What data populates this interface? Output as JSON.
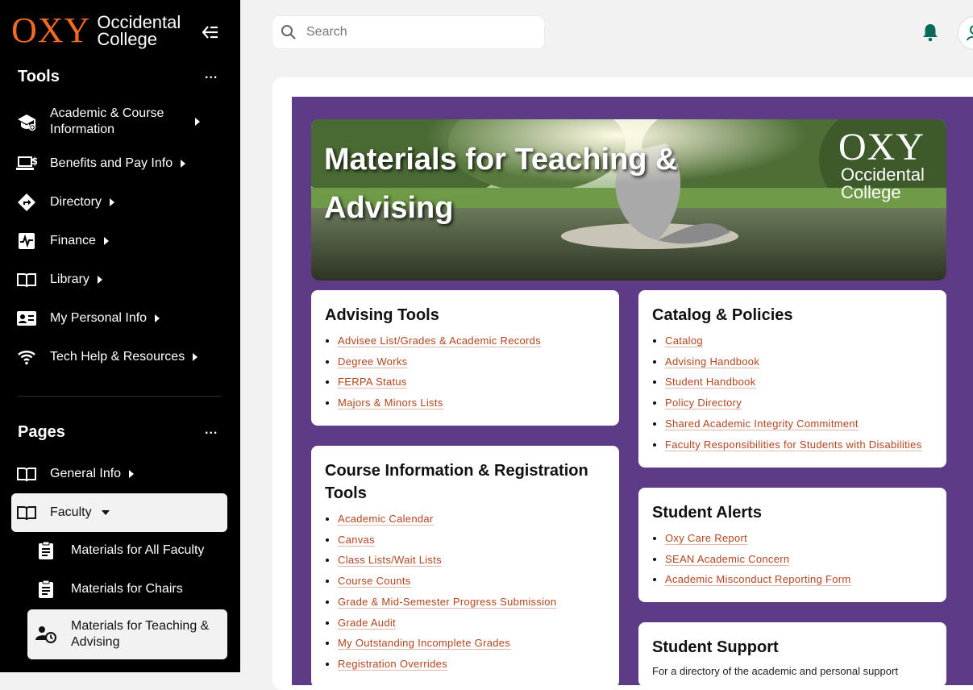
{
  "brand": {
    "logo_main": "OXY",
    "logo_line1": "Occidental",
    "logo_line2": "College",
    "accent": "#f26b21"
  },
  "sidebar": {
    "tools_title": "Tools",
    "pages_title": "Pages",
    "more": "...",
    "tools": [
      {
        "label": "Academic & Course Information",
        "icon": "graduation-cap-icon"
      },
      {
        "label": "Benefits and Pay Info",
        "icon": "laptop-dollar-icon"
      },
      {
        "label": "Directory",
        "icon": "directions-icon"
      },
      {
        "label": "Finance",
        "icon": "finance-chart-icon"
      },
      {
        "label": "Library",
        "icon": "book-icon"
      },
      {
        "label": "My Personal Info",
        "icon": "id-card-icon"
      },
      {
        "label": "Tech Help & Resources",
        "icon": "wifi-icon"
      }
    ],
    "pages": [
      {
        "label": "General Info",
        "icon": "book-icon"
      },
      {
        "label": "Faculty",
        "icon": "book-icon"
      }
    ],
    "faculty_sub": [
      {
        "label": "Materials for All Faculty",
        "icon": "clipboard-icon"
      },
      {
        "label": "Materials for Chairs",
        "icon": "clipboard-icon"
      },
      {
        "label": "Materials for Teaching & Advising",
        "icon": "user-clock-icon"
      }
    ]
  },
  "topbar": {
    "search_placeholder": "Search"
  },
  "hero": {
    "title": "Materials for Teaching & Advising",
    "logo_main": "OXY",
    "logo_line1": "Occidental",
    "logo_line2": "College"
  },
  "cards": {
    "advising": {
      "title": "Advising Tools",
      "links": [
        "Advisee List/Grades & Academic Records",
        "Degree Works",
        "FERPA Status",
        "Majors & Minors Lists"
      ]
    },
    "course": {
      "title": "Course Information & Registration Tools",
      "links": [
        "Academic Calendar",
        "Canvas",
        "Class Lists/Wait Lists",
        "Course Counts",
        "Grade & Mid-Semester Progress Submission",
        "Grade Audit",
        "My Outstanding Incomplete Grades",
        "Registration Overrides"
      ]
    },
    "catalog": {
      "title": "Catalog & Policies",
      "links": [
        "Catalog",
        "Advising Handbook",
        "Student Handbook",
        "Policy Directory",
        "Shared Academic Integrity Commitment",
        "Faculty Responsibilities for Students with Disabilities"
      ]
    },
    "alerts": {
      "title": "Student Alerts",
      "links": [
        "Oxy Care Report",
        "SEAN Academic Concern",
        "Academic Misconduct Reporting Form"
      ]
    },
    "support": {
      "title": "Student Support",
      "intro": "For a directory of the academic and personal support"
    }
  },
  "colors": {
    "purple": "#5d3b86",
    "link": "#b3441e",
    "bell": "#0b6b5a"
  }
}
